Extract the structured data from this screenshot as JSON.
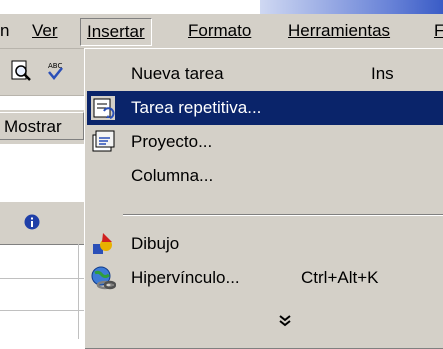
{
  "menubar": {
    "items": [
      {
        "label": "n"
      },
      {
        "label": "Ver"
      },
      {
        "label": "Insertar"
      },
      {
        "label": "Formato"
      },
      {
        "label": "Herramientas"
      },
      {
        "label": "F"
      }
    ]
  },
  "toolbar": {
    "mostrar_label": "Mostrar"
  },
  "menu": {
    "items": [
      {
        "label": "Nueva tarea",
        "shortcut": "Ins"
      },
      {
        "label": "Tarea repetitiva...",
        "shortcut": ""
      },
      {
        "label": "Proyecto...",
        "shortcut": ""
      },
      {
        "label": "Columna...",
        "shortcut": ""
      },
      {
        "label": "Dibujo",
        "shortcut": ""
      },
      {
        "label": "Hipervínculo...",
        "shortcut": "Ctrl+Alt+K"
      }
    ]
  },
  "colors": {
    "highlight": "#0a246a",
    "face": "#d4d0c8"
  },
  "icons": [
    "print-preview-icon",
    "spelling-icon",
    "recurring-task-icon",
    "project-icon",
    "drawing-icon",
    "hyperlink-icon",
    "info-icon",
    "expand-chevron-icon"
  ]
}
